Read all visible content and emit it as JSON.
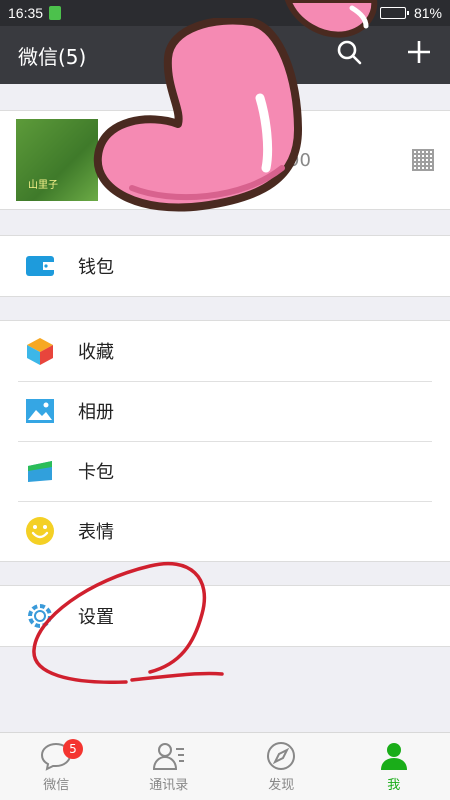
{
  "status_bar": {
    "time": "16:35",
    "battery": "81%",
    "battery_level": 0.81
  },
  "navbar": {
    "title": "微信(5)",
    "search_icon": "search-icon",
    "add_icon": "plus-icon"
  },
  "profile": {
    "avatar_text": "山里子",
    "id_fragment": "90"
  },
  "menu": {
    "wallet": "钱包",
    "favorites": "收藏",
    "album": "相册",
    "cards": "卡包",
    "stickers": "表情",
    "settings": "设置"
  },
  "tabbar": {
    "items": [
      {
        "label": "微信",
        "icon": "chat-icon",
        "badge": "5"
      },
      {
        "label": "通讯录",
        "icon": "contacts-icon"
      },
      {
        "label": "发现",
        "icon": "compass-icon"
      },
      {
        "label": "我",
        "icon": "person-icon"
      }
    ],
    "active_color": "#1aad19"
  },
  "colors": {
    "navbar": "#393a3f",
    "accent": "#1aad19",
    "badge": "#f43530",
    "annotation": "#d0202e",
    "heart": "#f58ab3"
  }
}
